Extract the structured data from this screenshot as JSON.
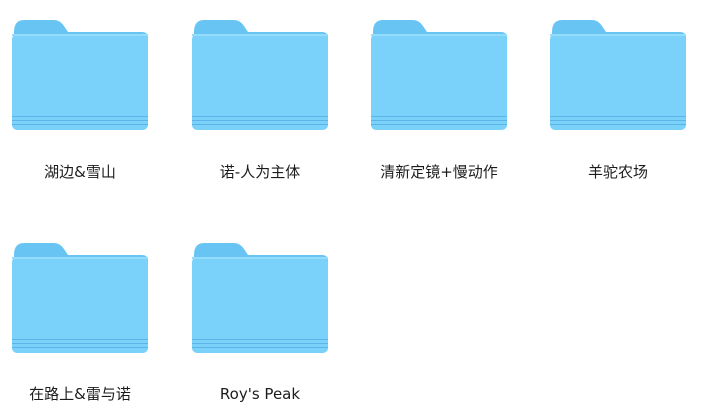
{
  "window": {
    "view": "icon-grid"
  },
  "colors": {
    "folder_back": "#68c5f3",
    "folder_front": "#7ad1fa",
    "folder_bottom_lines": "#5bb5e6",
    "label_text": "#1c1c1c"
  },
  "folders": [
    {
      "name": "湖边&雪山",
      "icon": "folder-icon"
    },
    {
      "name": "诺-人为主体",
      "icon": "folder-icon"
    },
    {
      "name": "清新定镜+慢动作",
      "icon": "folder-icon"
    },
    {
      "name": "羊驼农场",
      "icon": "folder-icon"
    },
    {
      "name": "在路上&雷与诺",
      "icon": "folder-icon"
    },
    {
      "name": "Roy's Peak",
      "icon": "folder-icon"
    }
  ]
}
